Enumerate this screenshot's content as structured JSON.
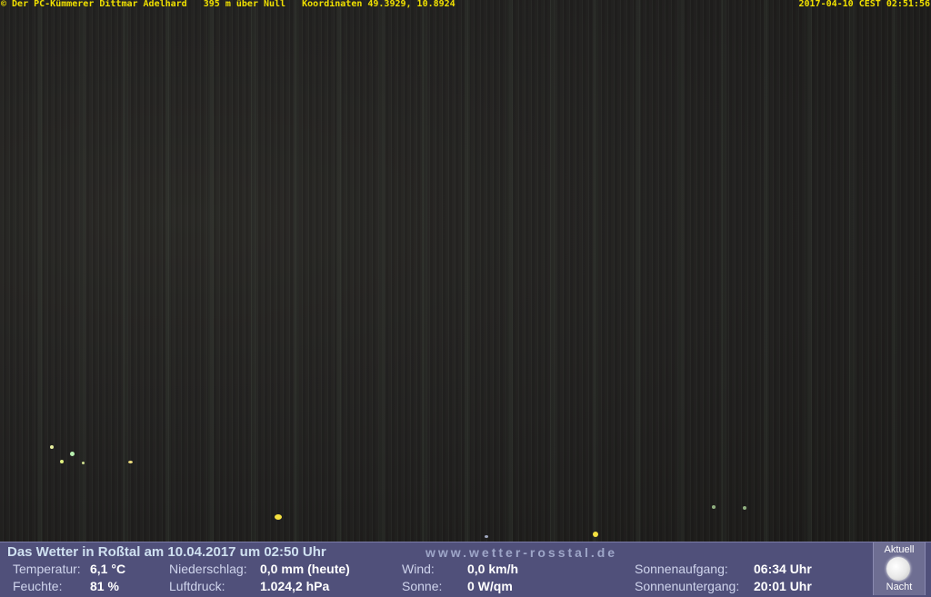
{
  "overlay": {
    "left_text": "© Der PC-Kümmerer Dittmar Adelhard   395 m über Null   Koordinaten 49.3929, 10.8924",
    "right_text": "2017-04-10 CEST 02:51:56"
  },
  "panel": {
    "headline": "Das Wetter in Roßtal am 10.04.2017 um 02:50 Uhr",
    "site": "www.wetter-rosstal.de",
    "temperature_label": "Temperatur:",
    "temperature_value": "6,1 °C",
    "humidity_label": "Feuchte:",
    "humidity_value": "81 %",
    "precip_label": "Niederschlag:",
    "precip_value": "0,0 mm (heute)",
    "pressure_label": "Luftdruck:",
    "pressure_value": "1.024,2 hPa",
    "wind_label": "Wind:",
    "wind_value": "0,0 km/h",
    "sun_label": "Sonne:",
    "sun_value": "0 W/qm",
    "sunrise_label": "Sonnenaufgang:",
    "sunrise_value": "06:34 Uhr",
    "sunset_label": "Sonnenuntergang:",
    "sunset_value": "20:01 Uhr",
    "moon_top_label": "Aktuell",
    "moon_bottom_label": "Nacht",
    "moon_icon": "full-moon-icon"
  }
}
